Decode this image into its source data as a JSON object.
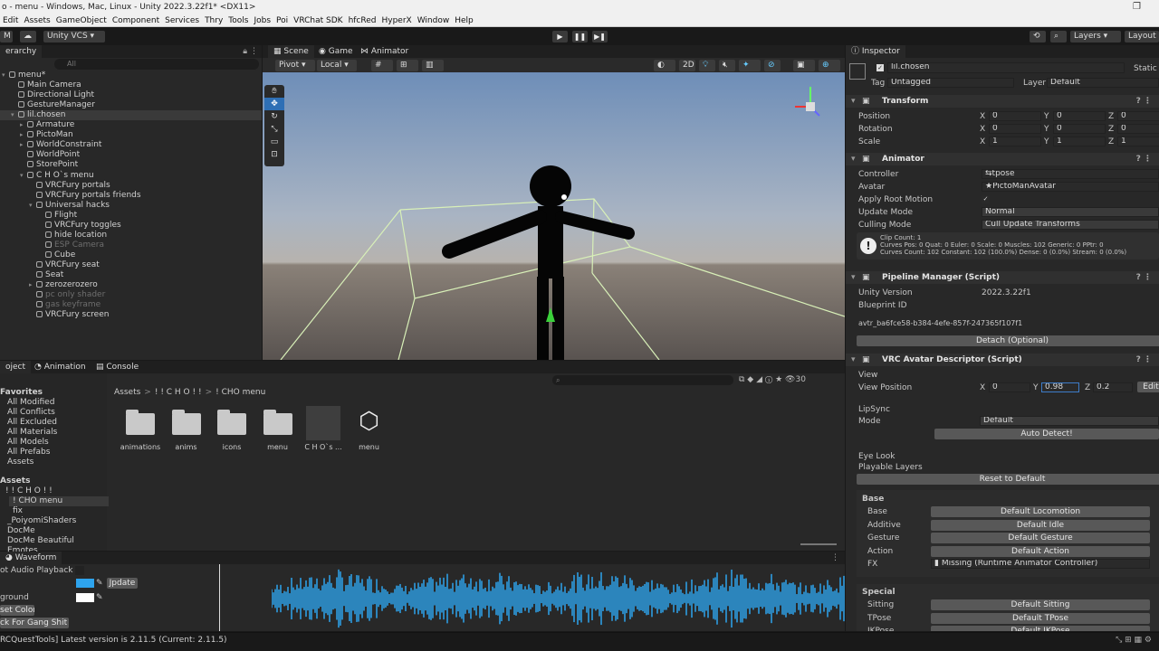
{
  "title": "o - menu - Windows, Mac, Linux - Unity 2022.3.22f1* <DX11>",
  "menus": [
    "Edit",
    "Assets",
    "GameObject",
    "Component",
    "Services",
    "Thry",
    "Tools",
    "Jobs",
    "Poi",
    "VRChat SDK",
    "hfcRed",
    "HyperX",
    "Window",
    "Help"
  ],
  "toolbar": {
    "account": "M",
    "vcs": "Unity VCS",
    "layers": "Layers",
    "layout": "Layout"
  },
  "hierarchy": {
    "tab": "erarchy",
    "search": "All",
    "rows": [
      {
        "t": "menu*",
        "d": 0
      },
      {
        "t": "Main Camera",
        "d": 1
      },
      {
        "t": "Directional Light",
        "d": 1
      },
      {
        "t": "GestureManager",
        "d": 1
      },
      {
        "t": "lil.chosen",
        "d": 1
      },
      {
        "t": "Armature",
        "d": 2
      },
      {
        "t": "PictoMan",
        "d": 2
      },
      {
        "t": "WorldConstraint",
        "d": 2
      },
      {
        "t": "WorldPoint",
        "d": 2
      },
      {
        "t": "StorePoint",
        "d": 2
      },
      {
        "t": "C H O`s menu",
        "d": 2
      },
      {
        "t": "VRCFury portals",
        "d": 3
      },
      {
        "t": "VRCFury portals friends",
        "d": 3
      },
      {
        "t": "Universal hacks",
        "d": 3
      },
      {
        "t": "Flight",
        "d": 4
      },
      {
        "t": "VRCFury toggles",
        "d": 4
      },
      {
        "t": "hide location",
        "d": 4
      },
      {
        "t": "ESP Camera",
        "d": 4
      },
      {
        "t": "Cube",
        "d": 4
      },
      {
        "t": "VRCFury seat",
        "d": 3
      },
      {
        "t": "Seat",
        "d": 3
      },
      {
        "t": "zerozerozero",
        "d": 3
      },
      {
        "t": "pc only shader",
        "d": 3
      },
      {
        "t": "gas keyframe",
        "d": 3
      },
      {
        "t": "VRCFury screen",
        "d": 3
      }
    ]
  },
  "scene": {
    "tabs": [
      "Scene",
      "Game",
      "Animator"
    ],
    "pivot": "Pivot",
    "local": "Local",
    "mode2d": "2D"
  },
  "project": {
    "tabs": [
      "oject",
      "Animation",
      "Console"
    ],
    "favorites_title": "Favorites",
    "favorites": [
      "All Modified",
      "All Conflicts",
      "All Excluded",
      "All Materials",
      "All Models",
      "All Prefabs",
      "Assets"
    ],
    "assets_title": "Assets",
    "tree": [
      "! ! C H O ! !",
      "! CHO menu",
      "fix",
      "_PoiyomiShaders",
      "DocMe",
      "DocMe Beautiful",
      "Emotes"
    ],
    "breadcrumb": [
      "Assets",
      "! ! C H O ! !",
      "! CHO menu"
    ],
    "items": [
      "animations",
      "anims",
      "icons",
      "menu",
      "C H O`s ...",
      "menu"
    ],
    "count": "30"
  },
  "waveform": {
    "tab": "Waveform",
    "rows": [
      "ot Audio Playback",
      "",
      "ground"
    ],
    "update": "Jpdate",
    "reset": "set Colors",
    "track": "ck For Gang Shit :3"
  },
  "status": "RCQuestTools] Latest version is 2.11.5 (Current: 2.11.5)",
  "inspector": {
    "tab": "Inspector",
    "name": "lil.chosen",
    "static": "Static",
    "tag_label": "Tag",
    "tag": "Untagged",
    "layer_label": "Layer",
    "layer": "Default",
    "transform": {
      "title": "Transform",
      "position": "Position",
      "rotation": "Rotation",
      "scale": "Scale",
      "pos": [
        "0",
        "0",
        "0"
      ],
      "rot": [
        "0",
        "0",
        "0"
      ],
      "scl": [
        "1",
        "1",
        "1"
      ]
    },
    "animator": {
      "title": "Animator",
      "controller_label": "Controller",
      "controller": "tpose",
      "avatar_label": "Avatar",
      "avatar": "PictoManAvatar",
      "root_label": "Apply Root Motion",
      "update_label": "Update Mode",
      "update": "Normal",
      "culling_label": "Culling Mode",
      "culling": "Cull Update Transforms",
      "info": [
        "Clip Count: 1",
        "Curves Pos: 0 Quat: 0 Euler: 0 Scale: 0 Muscles: 102 Generic: 0 PPtr: 0",
        "Curves Count: 102 Constant: 102 (100.0%) Dense: 0 (0.0%) Stream: 0 (0.0%)"
      ]
    },
    "pipeline": {
      "title": "Pipeline Manager (Script)",
      "version_label": "Unity Version",
      "version": "2022.3.22f1",
      "bp_label": "Blueprint ID",
      "bp": "avtr_ba6fce58-b384-4efe-857f-247365f107f1",
      "detach": "Detach (Optional)"
    },
    "descriptor": {
      "title": "VRC Avatar Descriptor (Script)",
      "view": "View",
      "viewpos_label": "View Position",
      "vx": "0",
      "vy": "0.98",
      "vz": "0.2",
      "edit": "Edit",
      "lipsync": "LipSync",
      "mode_label": "Mode",
      "mode": "Default",
      "autodetect": "Auto Detect!",
      "eyelook": "Eye Look",
      "playable": "Playable Layers",
      "reset": "Reset to Default",
      "base_title": "Base",
      "base": [
        {
          "k": "Base",
          "v": "Default Locomotion"
        },
        {
          "k": "Additive",
          "v": "Default Idle"
        },
        {
          "k": "Gesture",
          "v": "Default Gesture"
        },
        {
          "k": "Action",
          "v": "Default Action"
        }
      ],
      "fx_label": "FX",
      "fx": "Missing (Runtime Animator Controller)",
      "special_title": "Special",
      "special": [
        {
          "k": "Sitting",
          "v": "Default Sitting"
        },
        {
          "k": "TPose",
          "v": "Default TPose"
        },
        {
          "k": "IKPose",
          "v": "Default IKPose"
        }
      ]
    }
  },
  "colors": {
    "accent": "#2e7bd6",
    "waveform": "#2ea4ee",
    "bg": "#282828"
  }
}
